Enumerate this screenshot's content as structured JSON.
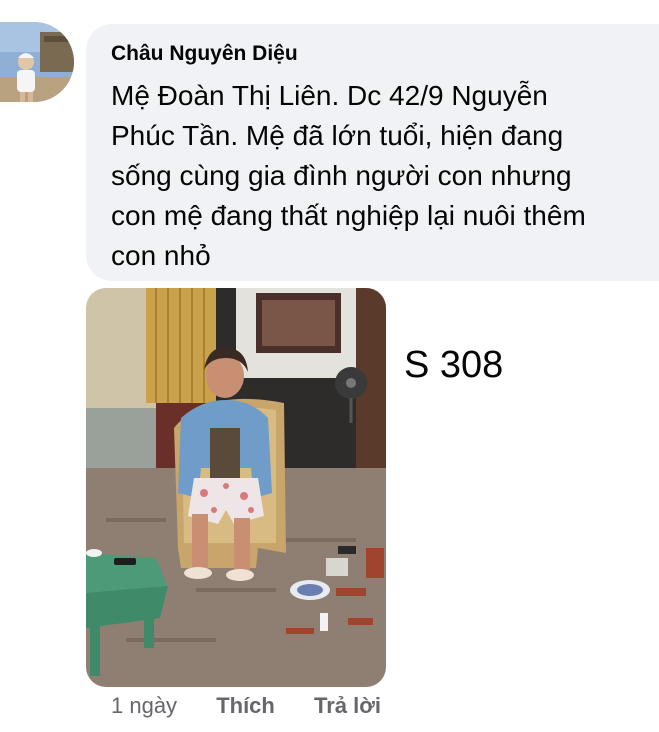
{
  "comment": {
    "author": "Châu Nguyên Diệu",
    "message_lines": [
      "Mệ Đoàn Thị Liên. Dc 42/9 Nguyễn",
      "Phúc Tần. Mệ đã lớn tuổi, hiện đang",
      "sống cùng gia đình người con nhưng",
      "con mệ đang thất nghiệp lại nuôi thêm",
      "con nhỏ"
    ],
    "bubble_color": "#f0f2f5"
  },
  "attachment": {
    "code_label": "S 308"
  },
  "actions": {
    "time": "1 ngày",
    "like_label": "Thích",
    "reply_label": "Trả lời",
    "action_color": "#65676b"
  }
}
